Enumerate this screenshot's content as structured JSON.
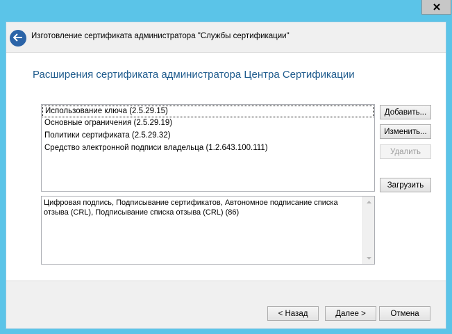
{
  "window": {
    "close_icon": "close-icon"
  },
  "header": {
    "back_icon": "back-arrow-icon",
    "title": "Изготовление сертификата администратора \"Службы сертификации\""
  },
  "main": {
    "heading": "Расширения сертификата администратора Центра Сертификации",
    "extensions": [
      {
        "label": "Использование ключа (2.5.29.15)",
        "selected": true
      },
      {
        "label": "Основные ограничения (2.5.29.19)",
        "selected": false
      },
      {
        "label": "Политики сертификата (2.5.29.32)",
        "selected": false
      },
      {
        "label": "Средство электронной подписи владельца (1.2.643.100.111)",
        "selected": false
      }
    ],
    "buttons": {
      "add": "Добавить...",
      "edit": "Изменить...",
      "delete": "Удалить",
      "load": "Загрузить"
    },
    "description": "Цифровая подпись, Подписывание сертификатов, Автономное подписание списка отзыва (CRL), Подписывание списка отзыва (CRL) (86)"
  },
  "footer": {
    "back_label": "< Назад",
    "next_label": "Далее >",
    "cancel_label": "Отмена"
  },
  "colors": {
    "frame": "#5bc4e8",
    "heading": "#1d5a8c",
    "back_button": "#2b64a8"
  }
}
